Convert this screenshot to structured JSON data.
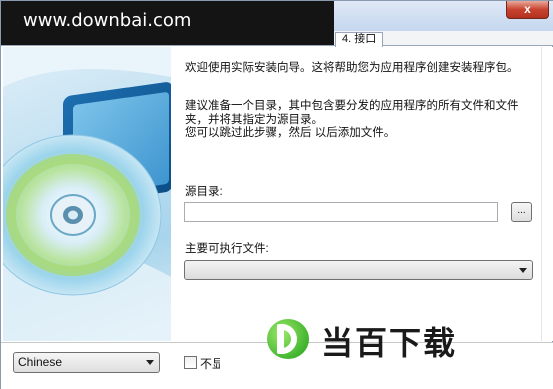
{
  "watermark": {
    "text": "www.downbai.com"
  },
  "titlebar": {
    "close_label": "x"
  },
  "tabs": [
    {
      "label": "4. 接口"
    }
  ],
  "intro": {
    "line1": "欢迎使用实际安装向导。这将帮助您为应用程序创建安装程序包。",
    "line2": "建议准备一个目录，其中包含要分发的应用程序的所有文件和文件夹，并将其指定为源目录。",
    "line3": "您可以跳过此步骤，然后 以后添加文件。"
  },
  "source": {
    "label": "源目录:",
    "value": "",
    "browse_label": "..."
  },
  "executable": {
    "label": "主要可执行文件:",
    "value": ""
  },
  "language": {
    "value": "Chinese"
  },
  "dont_show": {
    "label": "不显"
  },
  "logo": {
    "text": "当百下载"
  },
  "colors": {
    "logo_green": "#43b52f",
    "close_red": "#c8432f"
  }
}
